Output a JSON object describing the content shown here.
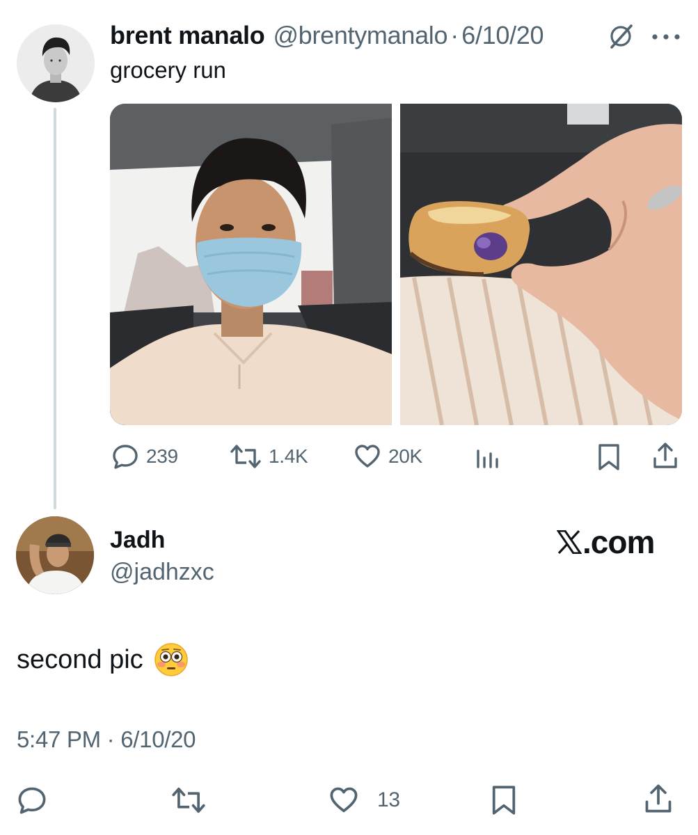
{
  "original_tweet": {
    "author_name": "brent manalo",
    "handle": "@brentymanalo",
    "separator": "·",
    "date": "6/10/20",
    "text": "grocery run",
    "images": [
      "selfie-in-car-with-mask",
      "hand-holding-pastry"
    ],
    "stats": {
      "replies": "239",
      "reposts": "1.4K",
      "likes": "20K"
    }
  },
  "reply_tweet": {
    "author_name": "Jadh",
    "handle": "@jadhzxc",
    "brand": "X.com",
    "brand_suffix": ".com",
    "text": "second pic",
    "emoji": "flushed-face",
    "time": "5:47 PM · 6/10/20",
    "stats": {
      "likes": "13"
    }
  },
  "colors": {
    "text": "#0f1419",
    "secondary": "#536471",
    "thread_line": "#cfd9de"
  }
}
